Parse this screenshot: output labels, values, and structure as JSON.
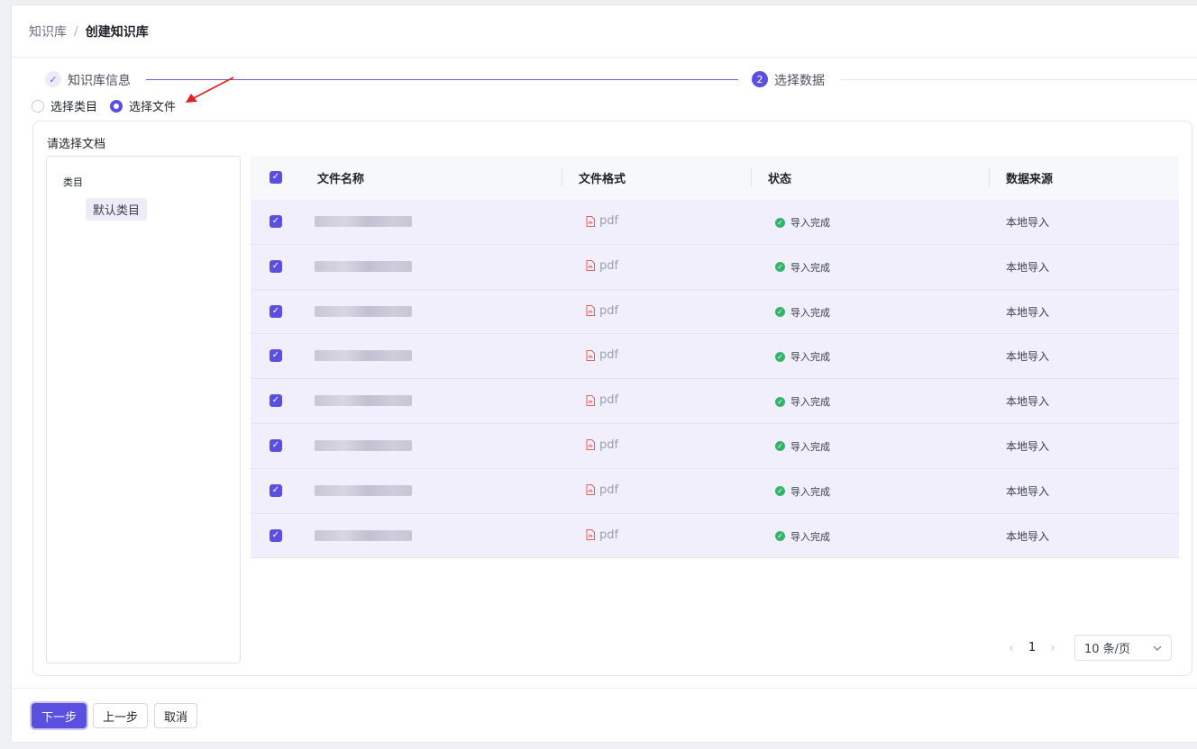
{
  "breadcrumb": {
    "parent": "知识库",
    "separator": "/",
    "current": "创建知识库"
  },
  "steps": [
    {
      "label": "知识库信息",
      "state": "done"
    },
    {
      "number": "2",
      "label": "选择数据",
      "state": "active"
    }
  ],
  "radios": [
    {
      "label": "选择类目",
      "checked": false
    },
    {
      "label": "选择文件",
      "checked": true
    }
  ],
  "panel": {
    "title": "请选择文档"
  },
  "tree": {
    "title": "类目",
    "items": [
      "默认类目"
    ]
  },
  "table": {
    "columns": [
      "文件名称",
      "文件格式",
      "状态",
      "数据来源"
    ],
    "rows": [
      {
        "format": "pdf",
        "status": "导入完成",
        "source": "本地导入"
      },
      {
        "format": "pdf",
        "status": "导入完成",
        "source": "本地导入"
      },
      {
        "format": "pdf",
        "status": "导入完成",
        "source": "本地导入"
      },
      {
        "format": "pdf",
        "status": "导入完成",
        "source": "本地导入"
      },
      {
        "format": "pdf",
        "status": "导入完成",
        "source": "本地导入"
      },
      {
        "format": "pdf",
        "status": "导入完成",
        "source": "本地导入"
      },
      {
        "format": "pdf",
        "status": "导入完成",
        "source": "本地导入"
      },
      {
        "format": "pdf",
        "status": "导入完成",
        "source": "本地导入"
      }
    ]
  },
  "pagination": {
    "page": "1",
    "page_size": "10 条/页"
  },
  "footer": {
    "next": "下一步",
    "prev": "上一步",
    "cancel": "取消"
  },
  "colors": {
    "primary": "#5b4fe0",
    "row_selected": "#f1effc",
    "success": "#34b36b",
    "pdf_icon": "#e25c5c"
  }
}
